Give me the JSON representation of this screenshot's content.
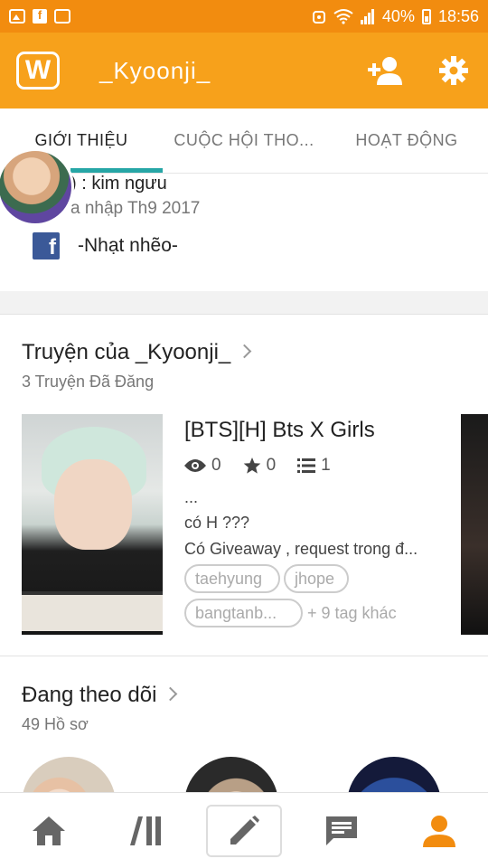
{
  "status_bar": {
    "battery": "40%",
    "time": "18:56",
    "icons": [
      "image-icon",
      "facebook-icon",
      "sync-icon",
      "alarm-icon",
      "wifi-icon",
      "signal-icon",
      "battery-icon"
    ]
  },
  "app_bar": {
    "logo_letter": "W",
    "title": "_Kyoonji_",
    "actions": [
      "add-friend-icon",
      "settings-icon"
    ]
  },
  "tabs": [
    {
      "label": "GIỚI THIỆU",
      "active": true
    },
    {
      "label": "CUỘC HỘI THO...",
      "active": false
    },
    {
      "label": "HOẠT ĐỘNG",
      "active": false
    }
  ],
  "about": {
    "line1": ") : kim ngưu",
    "line2": "a nhập Th9 2017",
    "facebook_name": "-Nhạt nhẽo-"
  },
  "stories_section": {
    "title": "Truyện của _Kyoonji_",
    "subtitle": "3 Truyện Đã Đăng",
    "story": {
      "title": "[BTS][H] Bts X Girls",
      "views": "0",
      "votes": "0",
      "parts": "1",
      "description": [
        "...",
        "có H ???",
        "Có Giveaway , request trong đ..."
      ],
      "tags": [
        "taehyung",
        "jhope",
        "bangtanb..."
      ],
      "more_tags": "+ 9 tag khác"
    }
  },
  "following_section": {
    "title": "Đang theo dõi",
    "subtitle": "49 Hồ sơ"
  },
  "bottom_nav": [
    "home-icon",
    "library-icon",
    "write-icon",
    "messages-icon",
    "profile-icon"
  ],
  "colors": {
    "status_bar": "#f28c0f",
    "app_bar": "#f7a11b",
    "tab_indicator": "#26a6a6",
    "active_nav": "#f28c0f"
  }
}
